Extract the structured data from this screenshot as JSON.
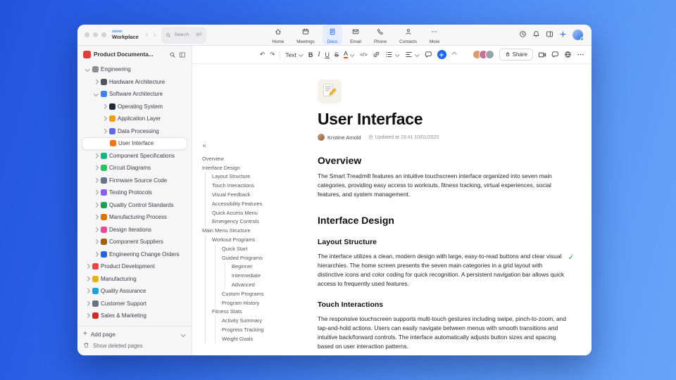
{
  "chrome": {
    "logo_top": "zoom",
    "logo_bottom": "Workplace",
    "search_placeholder": "Search",
    "search_shortcut": "⌘F",
    "tabs": [
      {
        "label": "Home"
      },
      {
        "label": "Meetings"
      },
      {
        "label": "Docs"
      },
      {
        "label": "Email"
      },
      {
        "label": "Phone"
      },
      {
        "label": "Contacts"
      },
      {
        "label": "More"
      }
    ]
  },
  "sidebar": {
    "title": "Product Documenta...",
    "tree": [
      {
        "label": "Engineering",
        "level": 0,
        "chevron": "down",
        "icon": "gear",
        "icon_color": "#8a8f98"
      },
      {
        "label": "Hardware Architecture",
        "level": 1,
        "chevron": "right",
        "icon": "chip",
        "icon_color": "#4b5563"
      },
      {
        "label": "Software Architecture",
        "level": 1,
        "chevron": "down",
        "icon": "floppy-disk",
        "icon_color": "#3b82f6"
      },
      {
        "label": "Operating System",
        "level": 2,
        "chevron": "right",
        "icon": "mobile",
        "icon_color": "#1f2937"
      },
      {
        "label": "Application Layer",
        "level": 2,
        "chevron": "right",
        "icon": "package",
        "icon_color": "#f59e0b"
      },
      {
        "label": "Data Processing",
        "level": 2,
        "chevron": "right",
        "icon": "bar-chart",
        "icon_color": "#6366f1"
      },
      {
        "label": "User Interface",
        "level": 2,
        "chevron": null,
        "icon": "monitor",
        "icon_color": "#f97316",
        "selected": true
      },
      {
        "label": "Component Specifications",
        "level": 1,
        "chevron": "right",
        "icon": "clipboard",
        "icon_color": "#10b981"
      },
      {
        "label": "Circuit Diagrams",
        "level": 1,
        "chevron": "right",
        "icon": "circuit",
        "icon_color": "#22c55e"
      },
      {
        "label": "Firmware Source Code",
        "level": 1,
        "chevron": "right",
        "icon": "code-file",
        "icon_color": "#64748b"
      },
      {
        "label": "Testing Protocols",
        "level": 1,
        "chevron": "right",
        "icon": "flask",
        "icon_color": "#8b5cf6"
      },
      {
        "label": "Quality Control Standards",
        "level": 1,
        "chevron": "right",
        "icon": "check-badge",
        "icon_color": "#16a34a"
      },
      {
        "label": "Manufacturing Process",
        "level": 1,
        "chevron": "right",
        "icon": "factory",
        "icon_color": "#d97706"
      },
      {
        "label": "Design Iterations",
        "level": 1,
        "chevron": "right",
        "icon": "palette",
        "icon_color": "#ec4899"
      },
      {
        "label": "Component Suppliers",
        "level": 1,
        "chevron": "right",
        "icon": "box",
        "icon_color": "#a16207"
      },
      {
        "label": "Engineering Change Orders",
        "level": 1,
        "chevron": "right",
        "icon": "document",
        "icon_color": "#2563eb"
      },
      {
        "label": "Product Development",
        "level": 0,
        "chevron": "right",
        "icon": "rocket",
        "icon_color": "#ef4444"
      },
      {
        "label": "Manufacturing",
        "level": 0,
        "chevron": "right",
        "icon": "factory",
        "icon_color": "#eab308"
      },
      {
        "label": "Quality Assurance",
        "level": 0,
        "chevron": "right",
        "icon": "shield",
        "icon_color": "#0ea5e9"
      },
      {
        "label": "Customer Support",
        "level": 0,
        "chevron": "right",
        "icon": "chat",
        "icon_color": "#6b7280"
      },
      {
        "label": "Sales & Marketing",
        "level": 0,
        "chevron": "right",
        "icon": "chart-up",
        "icon_color": "#dc2626"
      }
    ],
    "add_page_label": "Add page",
    "deleted_pages_label": "Show deleted pages"
  },
  "outline": {
    "items": [
      {
        "label": "Overview",
        "level": 0
      },
      {
        "label": "Interface Design",
        "level": 0
      },
      {
        "label": "Layout Structure",
        "level": 1
      },
      {
        "label": "Touch Interactions",
        "level": 1
      },
      {
        "label": "Visual Feedback",
        "level": 1
      },
      {
        "label": "Accessibility Features",
        "level": 1
      },
      {
        "label": "Quick Access Menu",
        "level": 1
      },
      {
        "label": "Emergency Controls",
        "level": 1
      },
      {
        "label": "Main Menu Structure",
        "level": 0
      },
      {
        "label": "Workout Programs",
        "level": 1
      },
      {
        "label": "Quick Start",
        "level": 2
      },
      {
        "label": "Guided Programs",
        "level": 2
      },
      {
        "label": "Beginner",
        "level": 3
      },
      {
        "label": "Intermediate",
        "level": 3
      },
      {
        "label": "Advanced",
        "level": 3
      },
      {
        "label": "Custom Programs",
        "level": 2
      },
      {
        "label": "Program History",
        "level": 2
      },
      {
        "label": "Fitness Stats",
        "level": 1
      },
      {
        "label": "Activity Summary",
        "level": 2
      },
      {
        "label": "Progress Tracking",
        "level": 2
      },
      {
        "label": "Weight Goals",
        "level": 2
      }
    ]
  },
  "toolbar": {
    "text_style_label": "Text",
    "bold_label": "B",
    "italic_label": "I",
    "underline_label": "U",
    "strikethrough_label": "S",
    "text_color_label": "A",
    "code_label": "</>",
    "share_label": "Share"
  },
  "doc": {
    "title": "User Interface",
    "author": "Kristine Arnold",
    "updated": "Updated at 19:41 10/01/2020",
    "overview_heading": "Overview",
    "overview_text": "The Smart Treadmill features an intuitive touchscreen interface organized into seven main categories, providing easy access to workouts, fitness tracking, virtual experiences, social features, and system management.",
    "design_heading": "Interface Design",
    "layout_heading": "Layout Structure",
    "layout_text": "The interface utilizes a clean, modern design with large, easy-to-read buttons and clear visual hierarchies. The home screen presents the seven main categories in a grid layout with distinctive icons and color coding for quick recognition. A persistent navigation bar allows quick access to frequently used features.",
    "touch_heading": "Touch Interactions",
    "touch_text": "The responsive touchscreen supports multi-touch gestures including swipe, pinch-to-zoom, and tap-and-hold actions. Users can easily navigate between menus with smooth transitions and intuitive back/forward controls. The interface automatically adjusts button sizes and spacing based on user interaction patterns."
  }
}
